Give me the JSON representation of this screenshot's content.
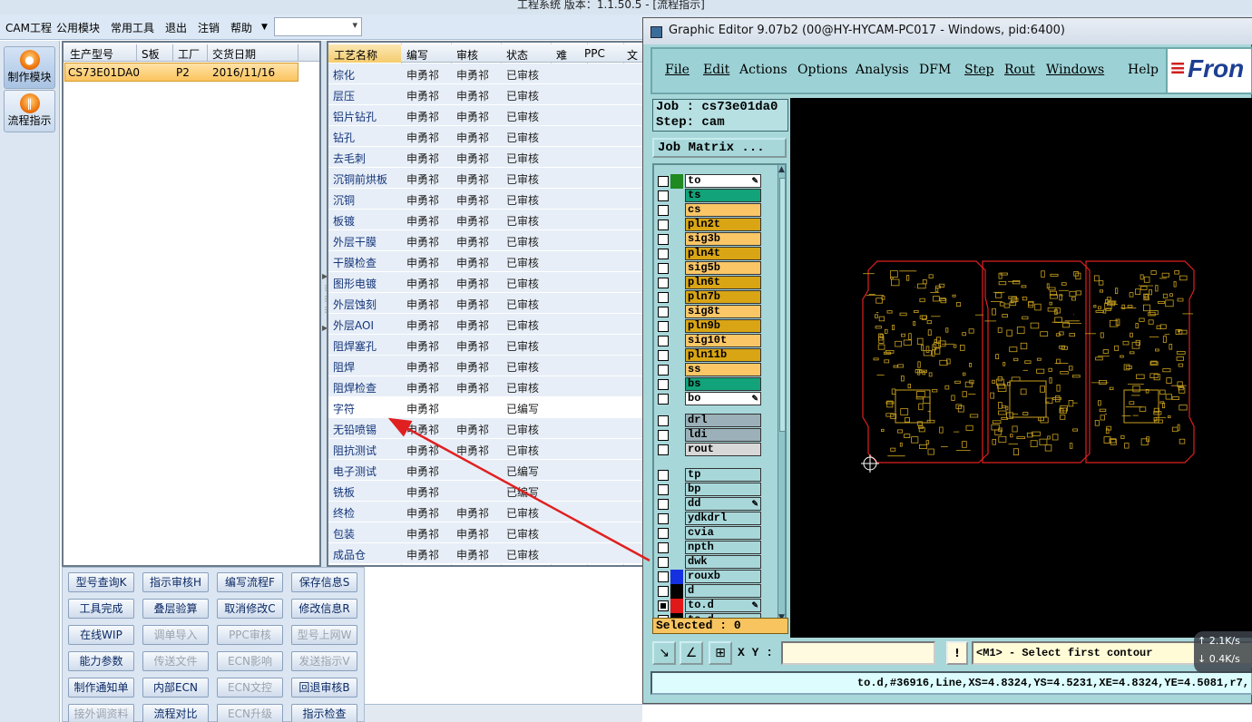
{
  "app": {
    "title": "工程系统   版本：1.1.50.5 - [流程指示]",
    "menu": [
      "CAM工程",
      "公用模块",
      "常用工具",
      "退出",
      "注销",
      "帮助"
    ],
    "menu_combo_value": ""
  },
  "leftbar": {
    "modules": [
      {
        "label": "制作模块",
        "icon": "fire-icon",
        "active": true
      },
      {
        "label": "流程指示",
        "icon": "flow-icon",
        "active": false
      }
    ]
  },
  "products": {
    "headers": [
      "生产型号",
      "S板",
      "工厂",
      "交货日期"
    ],
    "rows": [
      {
        "model": "CS73E01DA0",
        "sboard": "",
        "factory": "P2",
        "date": "2016/11/16"
      }
    ]
  },
  "process": {
    "headers": [
      "工艺名称",
      "编写",
      "审核",
      "状态",
      "难",
      "PPC",
      "文"
    ],
    "rows": [
      [
        "棕化",
        "申勇祁",
        "申勇祁",
        "已审核"
      ],
      [
        "层压",
        "申勇祁",
        "申勇祁",
        "已审核"
      ],
      [
        "铝片钻孔",
        "申勇祁",
        "申勇祁",
        "已审核"
      ],
      [
        "钻孔",
        "申勇祁",
        "申勇祁",
        "已审核"
      ],
      [
        "去毛刺",
        "申勇祁",
        "申勇祁",
        "已审核"
      ],
      [
        "沉铜前烘板",
        "申勇祁",
        "申勇祁",
        "已审核"
      ],
      [
        "沉铜",
        "申勇祁",
        "申勇祁",
        "已审核"
      ],
      [
        "板镀",
        "申勇祁",
        "申勇祁",
        "已审核"
      ],
      [
        "外层干膜",
        "申勇祁",
        "申勇祁",
        "已审核"
      ],
      [
        "干膜检查",
        "申勇祁",
        "申勇祁",
        "已审核"
      ],
      [
        "图形电镀",
        "申勇祁",
        "申勇祁",
        "已审核"
      ],
      [
        "外层蚀刻",
        "申勇祁",
        "申勇祁",
        "已审核"
      ],
      [
        "外层AOI",
        "申勇祁",
        "申勇祁",
        "已审核"
      ],
      [
        "阻焊塞孔",
        "申勇祁",
        "申勇祁",
        "已审核"
      ],
      [
        "阻焊",
        "申勇祁",
        "申勇祁",
        "已审核"
      ],
      [
        "阻焊检查",
        "申勇祁",
        "申勇祁",
        "已审核"
      ],
      [
        "字符",
        "申勇祁",
        "",
        "已编写"
      ],
      [
        "无铅喷锡",
        "申勇祁",
        "申勇祁",
        "已审核"
      ],
      [
        "阻抗测试",
        "申勇祁",
        "申勇祁",
        "已审核"
      ],
      [
        "电子测试",
        "申勇祁",
        "",
        "已编写"
      ],
      [
        "铣板",
        "申勇祁",
        "",
        "已编写"
      ],
      [
        "终检",
        "申勇祁",
        "申勇祁",
        "已审核"
      ],
      [
        "包装",
        "申勇祁",
        "申勇祁",
        "已审核"
      ],
      [
        "成品仓",
        "申勇祁",
        "申勇祁",
        "已审核"
      ]
    ]
  },
  "function_buttons": [
    [
      {
        "label": "型号查询K",
        "enabled": true
      },
      {
        "label": "指示审核H",
        "enabled": true
      },
      {
        "label": "编写流程F",
        "enabled": true
      },
      {
        "label": "保存信息S",
        "enabled": true
      }
    ],
    [
      {
        "label": "工具完成",
        "enabled": true
      },
      {
        "label": "叠层验算",
        "enabled": true
      },
      {
        "label": "取消修改C",
        "enabled": true
      },
      {
        "label": "修改信息R",
        "enabled": true
      }
    ],
    [
      {
        "label": "在线WIP",
        "enabled": true
      },
      {
        "label": "调单导入",
        "enabled": false
      },
      {
        "label": "PPC审核",
        "enabled": false
      },
      {
        "label": "型号上网W",
        "enabled": false
      }
    ],
    [
      {
        "label": "能力参数",
        "enabled": true
      },
      {
        "label": "传送文件",
        "enabled": false
      },
      {
        "label": "ECN影响",
        "enabled": false
      },
      {
        "label": "发送指示V",
        "enabled": false
      }
    ],
    [
      {
        "label": "制作通知单",
        "enabled": true
      },
      {
        "label": "内部ECN",
        "enabled": true
      },
      {
        "label": "ECN文控",
        "enabled": false
      },
      {
        "label": "回退审核B",
        "enabled": true
      }
    ],
    [
      {
        "label": "接外调资料",
        "enabled": false
      },
      {
        "label": "流程对比",
        "enabled": true
      },
      {
        "label": "ECN升级",
        "enabled": false
      },
      {
        "label": "指示检查",
        "enabled": true
      }
    ]
  ],
  "graphic_editor": {
    "title": "Graphic Editor 9.07b2 (00@HY-HYCAM-PC017 - Windows, pid:6400)",
    "menu": [
      "File",
      "Edit",
      "Actions",
      "Options",
      "Analysis",
      "DFM",
      "Step",
      "Rout",
      "Windows",
      "Help"
    ],
    "logo": "Fron",
    "job_line": "Job : cs73e01da0",
    "step_line": "Step: cam",
    "job_matrix_label": "Job Matrix ...",
    "layers_group1": [
      {
        "name": "to",
        "color": "#ffffff",
        "swatch": "#1f8a1f",
        "edit": true
      },
      {
        "name": "ts",
        "color": "#12a37a",
        "swatch": "",
        "edit": false
      },
      {
        "name": "cs",
        "color": "#fac666",
        "swatch": "",
        "edit": false
      },
      {
        "name": "pln2t",
        "color": "#d9a514",
        "swatch": "",
        "edit": false
      },
      {
        "name": "sig3b",
        "color": "#fac666",
        "swatch": "",
        "edit": false
      },
      {
        "name": "pln4t",
        "color": "#d9a514",
        "swatch": "",
        "edit": false
      },
      {
        "name": "sig5b",
        "color": "#fac666",
        "swatch": "",
        "edit": false
      },
      {
        "name": "pln6t",
        "color": "#d9a514",
        "swatch": "",
        "edit": false
      },
      {
        "name": "pln7b",
        "color": "#d9a514",
        "swatch": "",
        "edit": false
      },
      {
        "name": "sig8t",
        "color": "#fac666",
        "swatch": "",
        "edit": false
      },
      {
        "name": "pln9b",
        "color": "#d9a514",
        "swatch": "",
        "edit": false
      },
      {
        "name": "sig10t",
        "color": "#fac666",
        "swatch": "",
        "edit": false
      },
      {
        "name": "pln11b",
        "color": "#d9a514",
        "swatch": "",
        "edit": false
      },
      {
        "name": "ss",
        "color": "#fac666",
        "swatch": "",
        "edit": false
      },
      {
        "name": "bs",
        "color": "#12a37a",
        "swatch": "",
        "edit": false
      },
      {
        "name": "bo",
        "color": "#ffffff",
        "swatch": "",
        "edit": true
      }
    ],
    "layers_group2": [
      {
        "name": "drl",
        "color": "#9bb0b8",
        "swatch": "",
        "edit": false
      },
      {
        "name": "ldi",
        "color": "#9bb0b8",
        "swatch": "",
        "edit": false
      },
      {
        "name": "rout",
        "color": "#d8d8d8",
        "swatch": "",
        "edit": false
      }
    ],
    "layers_group3": [
      {
        "name": "tp",
        "color": "#a8d7da",
        "swatch": "",
        "edit": false
      },
      {
        "name": "bp",
        "color": "#a8d7da",
        "swatch": "",
        "edit": false
      },
      {
        "name": "dd",
        "color": "#a8d7da",
        "swatch": "",
        "edit": true
      },
      {
        "name": "ydkdrl",
        "color": "#a8d7da",
        "swatch": "",
        "edit": false
      },
      {
        "name": "cvia",
        "color": "#a8d7da",
        "swatch": "",
        "edit": false
      },
      {
        "name": "npth",
        "color": "#a8d7da",
        "swatch": "",
        "edit": false
      },
      {
        "name": "dwk",
        "color": "#a8d7da",
        "swatch": "",
        "edit": false
      },
      {
        "name": "rouxb",
        "color": "#a8d7da",
        "swatch": "#1530e0",
        "edit": false
      },
      {
        "name": "d",
        "color": "#a8d7da",
        "swatch": "#000000",
        "edit": false
      },
      {
        "name": "to.d",
        "color": "#a8d7da",
        "swatch": "#e01818",
        "edit": true,
        "checked": true
      },
      {
        "name": "ts.d",
        "color": "#a8d7da",
        "swatch": "#000000",
        "edit": false
      }
    ],
    "selected_text": "Selected : 0",
    "xy_label": "X Y :",
    "xy_value": "",
    "prompt": "<M1> - Select first contour",
    "status_line": "to.d,#36916,Line,XS=4.8324,YS=4.5231,XE=4.8324,YE=4.5081,r7,"
  },
  "speed": {
    "up": "2.1K/s",
    "down": "0.4K/s"
  },
  "colors": {
    "accent_orange": "#fbc45e",
    "ge_background": "#a8d7da",
    "pcb_outline": "#e02020",
    "pcb_trace": "#c9a020"
  }
}
